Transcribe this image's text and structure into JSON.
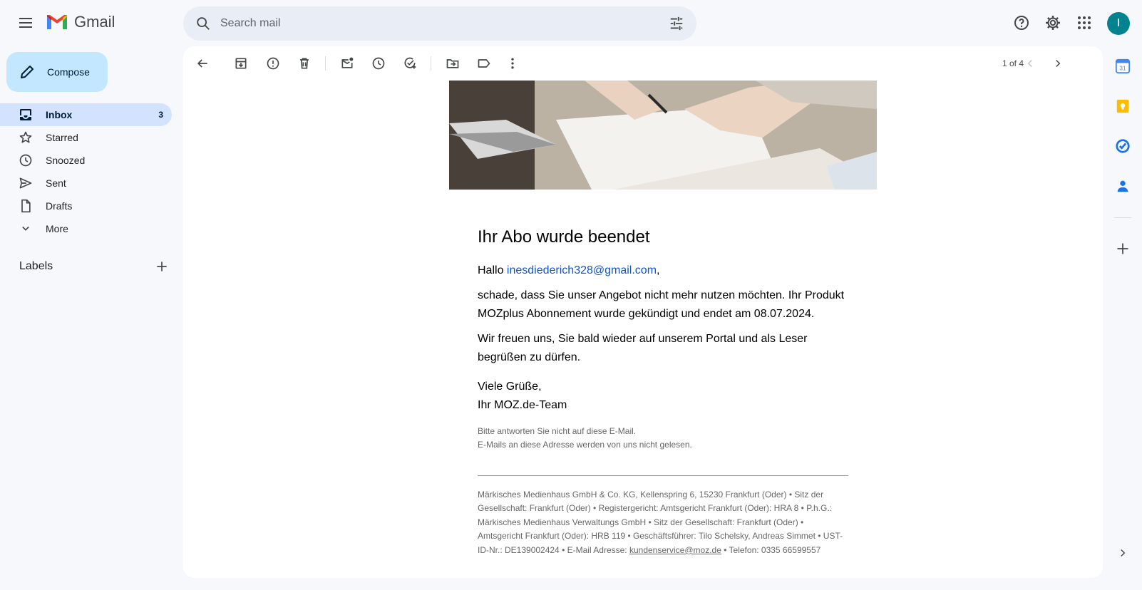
{
  "header": {
    "app_name": "Gmail",
    "search_placeholder": "Search mail",
    "avatar_letter": "I"
  },
  "sidebar": {
    "compose_label": "Compose",
    "items": [
      {
        "label": "Inbox",
        "count": "3",
        "icon": "inbox-icon"
      },
      {
        "label": "Starred",
        "icon": "star-icon"
      },
      {
        "label": "Snoozed",
        "icon": "clock-icon"
      },
      {
        "label": "Sent",
        "icon": "send-icon"
      },
      {
        "label": "Drafts",
        "icon": "draft-icon"
      },
      {
        "label": "More",
        "icon": "chevron-down-icon"
      }
    ],
    "labels_title": "Labels"
  },
  "toolbar": {
    "pager_text": "1 of 4"
  },
  "email": {
    "title": "Ihr Abo wurde beendet",
    "greeting_prefix": "Hallo ",
    "greeting_email": "inesdiederich328@gmail.com",
    "greeting_suffix": ",",
    "para1": "schade, dass Sie unser Angebot nicht mehr nutzen möchten. Ihr Produkt MOZplus Abonnement wurde gekündigt und endet am 08.07.2024.",
    "para2": "Wir freuen uns, Sie bald wieder auf unserem Portal und als Leser begrüßen zu dürfen.",
    "closing1": "Viele Grüße,",
    "closing2": "Ihr MOZ.de-Team",
    "note1": "Bitte antworten Sie nicht auf diese E-Mail.",
    "note2": "E-Mails an diese Adresse werden von uns nicht gelesen.",
    "footer_text": "Märkisches Medienhaus GmbH & Co. KG, Kellenspring 6, 15230 Frankfurt (Oder) • Sitz der Gesellschaft: Frankfurt (Oder) • Registergericht: Amtsgericht Frankfurt (Oder): HRA 8 • P.h.G.: Märkisches Medienhaus Verwaltungs GmbH • Sitz der Gesellschaft: Frankfurt (Oder) • Amtsgericht Frankfurt (Oder): HRB 119 • Geschäftsführer: Tilo Schelsky, Andreas Simmet • UST-ID-Nr.: DE139002424 • E-Mail Adresse: ",
    "footer_email": "kundenservice@moz.de",
    "footer_phone": " • Telefon: 0335 66599557"
  },
  "colors": {
    "accent": "#c2e7ff",
    "active_nav": "#d3e3fd",
    "avatar": "#00838f",
    "link": "#1155cc"
  }
}
